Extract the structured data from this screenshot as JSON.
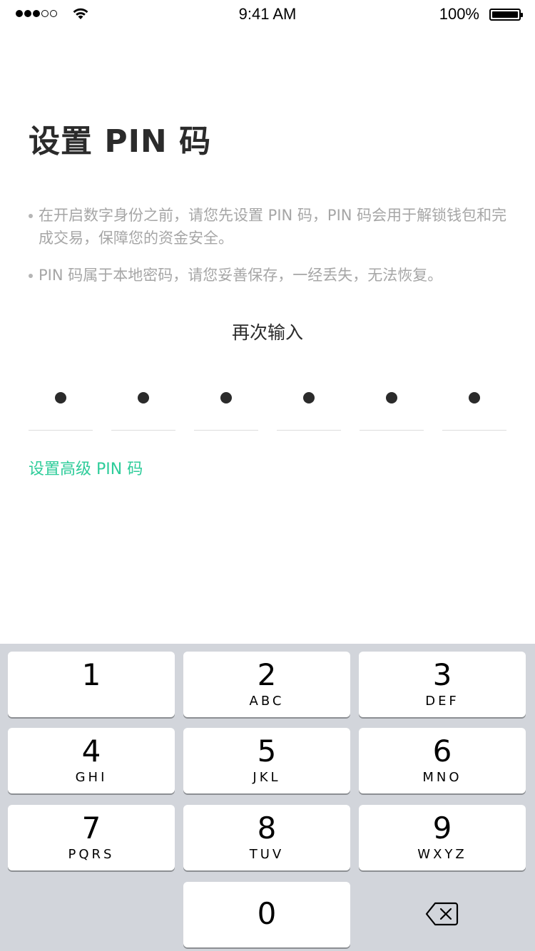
{
  "status_bar": {
    "time": "9:41 AM",
    "battery": "100%",
    "signal_bars": 3
  },
  "title": "设置 PIN 码",
  "notes": [
    "在开启数字身份之前，请您先设置 PIN 码，PIN 码会用于解锁钱包和完成交易，保障您的资金安全。",
    "PIN 码属于本地密码，请您妥善保存，一经丢失，无法恢复。"
  ],
  "reenter_label": "再次输入",
  "pin": {
    "length": 6,
    "filled": 6
  },
  "advanced_link": "设置高级 PIN 码",
  "colors": {
    "accent": "#2ecc9a",
    "text": "#2b2b2b",
    "muted": "#a6a6a6",
    "keypad_bg": "#d2d5db"
  },
  "keypad": {
    "keys": [
      {
        "digit": "1",
        "letters": ""
      },
      {
        "digit": "2",
        "letters": "ABC"
      },
      {
        "digit": "3",
        "letters": "DEF"
      },
      {
        "digit": "4",
        "letters": "GHI"
      },
      {
        "digit": "5",
        "letters": "JKL"
      },
      {
        "digit": "6",
        "letters": "MNO"
      },
      {
        "digit": "7",
        "letters": "PQRS"
      },
      {
        "digit": "8",
        "letters": "TUV"
      },
      {
        "digit": "9",
        "letters": "WXYZ"
      },
      {
        "digit": "0",
        "letters": ""
      }
    ],
    "delete_icon": "backspace-icon"
  }
}
